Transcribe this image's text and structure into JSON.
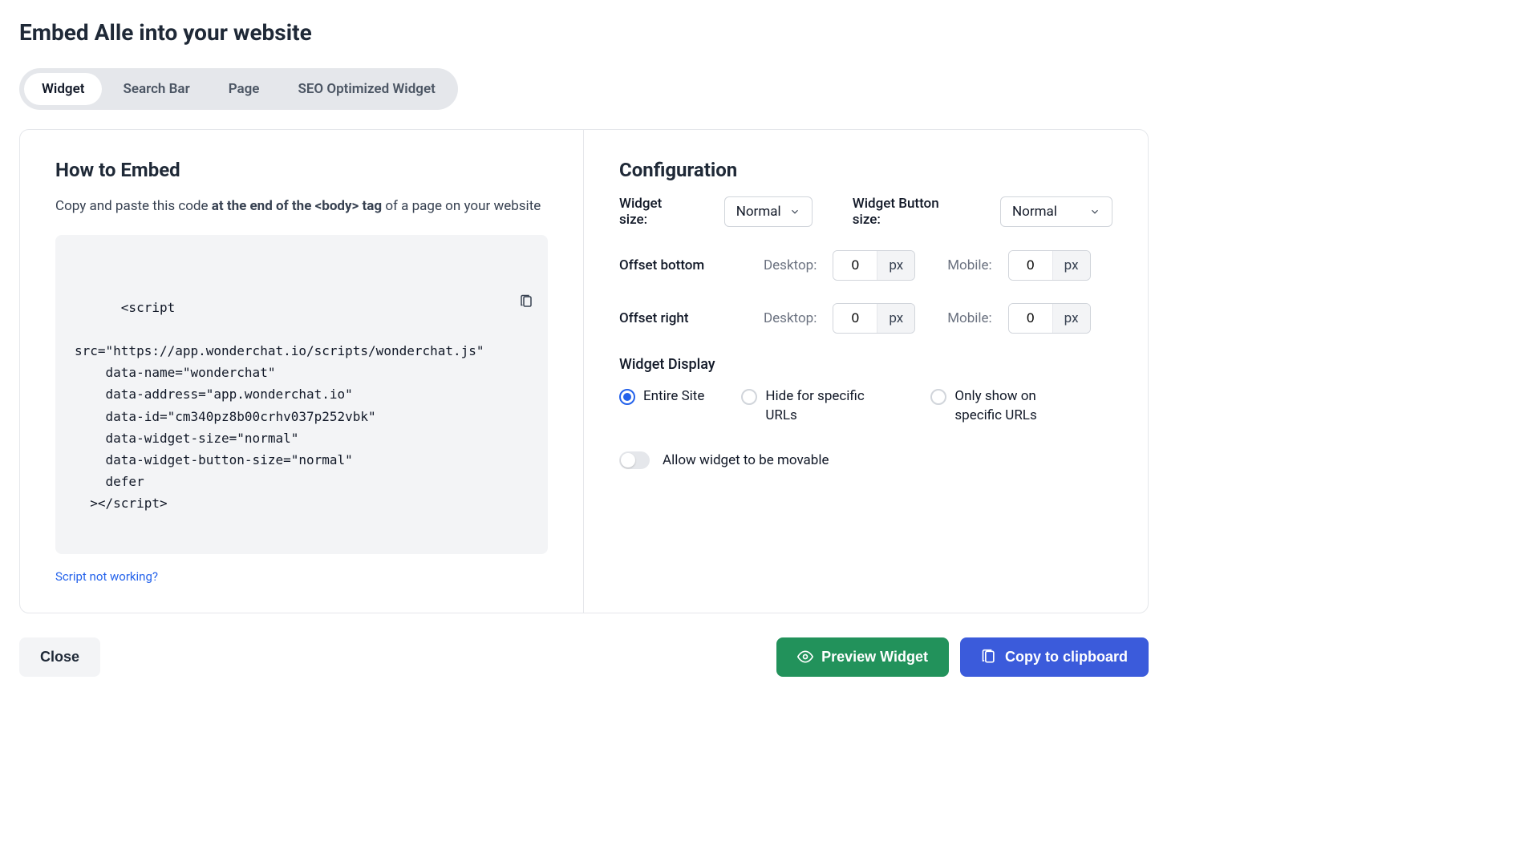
{
  "page": {
    "title": "Embed Alle into your website"
  },
  "tabs": {
    "items": [
      {
        "label": "Widget",
        "active": true
      },
      {
        "label": "Search Bar",
        "active": false
      },
      {
        "label": "Page",
        "active": false
      },
      {
        "label": "SEO Optimized Widget",
        "active": false
      }
    ]
  },
  "how_to_embed": {
    "heading": "How to Embed",
    "desc_pre": "Copy and paste this code ",
    "desc_bold": "at the end of the <body> tag",
    "desc_post": " of a page on your website",
    "code": "<script\n\nsrc=\"https://app.wonderchat.io/scripts/wonderchat.js\"\n    data-name=\"wonderchat\"\n    data-address=\"app.wonderchat.io\"\n    data-id=\"cm340pz8b00crhv037p252vbk\"\n    data-widget-size=\"normal\"\n    data-widget-button-size=\"normal\"\n    defer\n  ></script>",
    "help_link": "Script not working?"
  },
  "configuration": {
    "heading": "Configuration",
    "widget_size": {
      "label": "Widget size:",
      "value": "Normal"
    },
    "widget_button_size": {
      "label": "Widget Button size:",
      "value": "Normal"
    },
    "offset_bottom": {
      "label": "Offset bottom",
      "desktop_label": "Desktop:",
      "desktop_value": "0",
      "desktop_unit": "px",
      "mobile_label": "Mobile:",
      "mobile_value": "0",
      "mobile_unit": "px"
    },
    "offset_right": {
      "label": "Offset right",
      "desktop_label": "Desktop:",
      "desktop_value": "0",
      "desktop_unit": "px",
      "mobile_label": "Mobile:",
      "mobile_value": "0",
      "mobile_unit": "px"
    },
    "widget_display": {
      "heading": "Widget Display",
      "options": [
        {
          "label": "Entire Site",
          "selected": true
        },
        {
          "label": "Hide for specific URLs",
          "selected": false
        },
        {
          "label": "Only show on specific URLs",
          "selected": false
        }
      ]
    },
    "movable": {
      "label": "Allow widget to be movable",
      "enabled": false
    }
  },
  "footer": {
    "close": "Close",
    "preview": "Preview Widget",
    "copy": "Copy to clipboard"
  }
}
